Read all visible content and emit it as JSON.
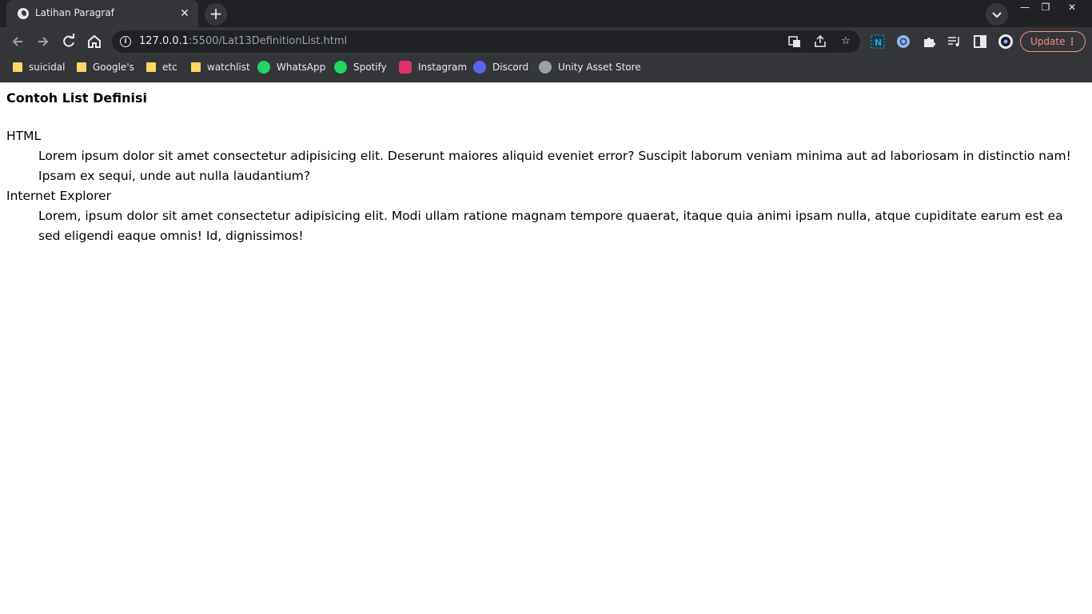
{
  "browser": {
    "tab_title": "Latihan Paragraf",
    "tab_close": "✕",
    "new_tab": "+",
    "url_host": "127.0.0.1",
    "url_path": ":5500/Lat13DefinitionList.html",
    "update_label": "Update",
    "window_controls": {
      "minimize": "—",
      "restore": "❐",
      "close": "✕"
    }
  },
  "bookmarks": [
    {
      "label": "suicidal",
      "icon": "folder-icon"
    },
    {
      "label": "Google's",
      "icon": "folder-icon"
    },
    {
      "label": "etc",
      "icon": "folder-icon"
    },
    {
      "label": "watchlist",
      "icon": "folder-icon"
    },
    {
      "label": "WhatsApp",
      "icon": "whatsapp-icon",
      "color": "#25d366"
    },
    {
      "label": "Spotify",
      "icon": "spotify-icon",
      "color": "#1ed760"
    },
    {
      "label": "Instagram",
      "icon": "instagram-icon",
      "color": "#e1306c"
    },
    {
      "label": "Discord",
      "icon": "discord-icon",
      "color": "#5865f2"
    },
    {
      "label": "Unity Asset Store",
      "icon": "unity-icon",
      "color": "#9aa0a6"
    }
  ],
  "page": {
    "heading": "Contoh List Definisi",
    "definitions": [
      {
        "term": "HTML",
        "description": "Lorem ipsum dolor sit amet consectetur adipisicing elit. Deserunt maiores aliquid eveniet error? Suscipit laborum veniam minima aut ad laboriosam in distinctio nam! Ipsam ex sequi, unde aut nulla laudantium?"
      },
      {
        "term": "Internet Explorer",
        "description": "Lorem, ipsum dolor sit amet consectetur adipisicing elit. Modi ullam ratione magnam tempore quaerat, itaque quia animi ipsam nulla, atque cupiditate earum est ea sed eligendi eaque omnis! Id, dignissimos!"
      }
    ]
  }
}
